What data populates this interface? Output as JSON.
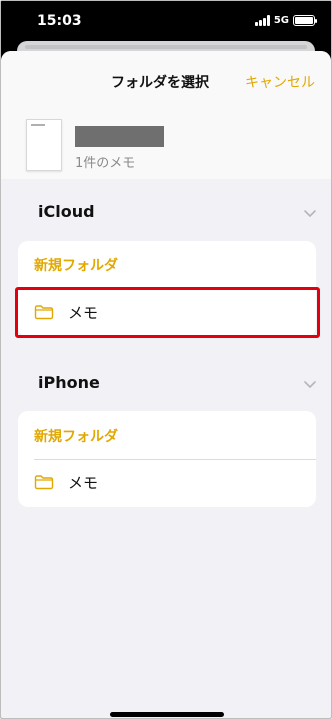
{
  "status": {
    "time": "15:03",
    "network": "5G"
  },
  "header": {
    "title": "フォルダを選択",
    "cancel_label": "キャンセル"
  },
  "note": {
    "count_label": "1件のメモ"
  },
  "sections": [
    {
      "title": "iCloud",
      "new_folder_label": "新規フォルダ",
      "folder_label": "メモ"
    },
    {
      "title": "iPhone",
      "new_folder_label": "新規フォルダ",
      "folder_label": "メモ"
    }
  ],
  "colors": {
    "accent": "#e2a800",
    "highlight": "#e0000e"
  }
}
